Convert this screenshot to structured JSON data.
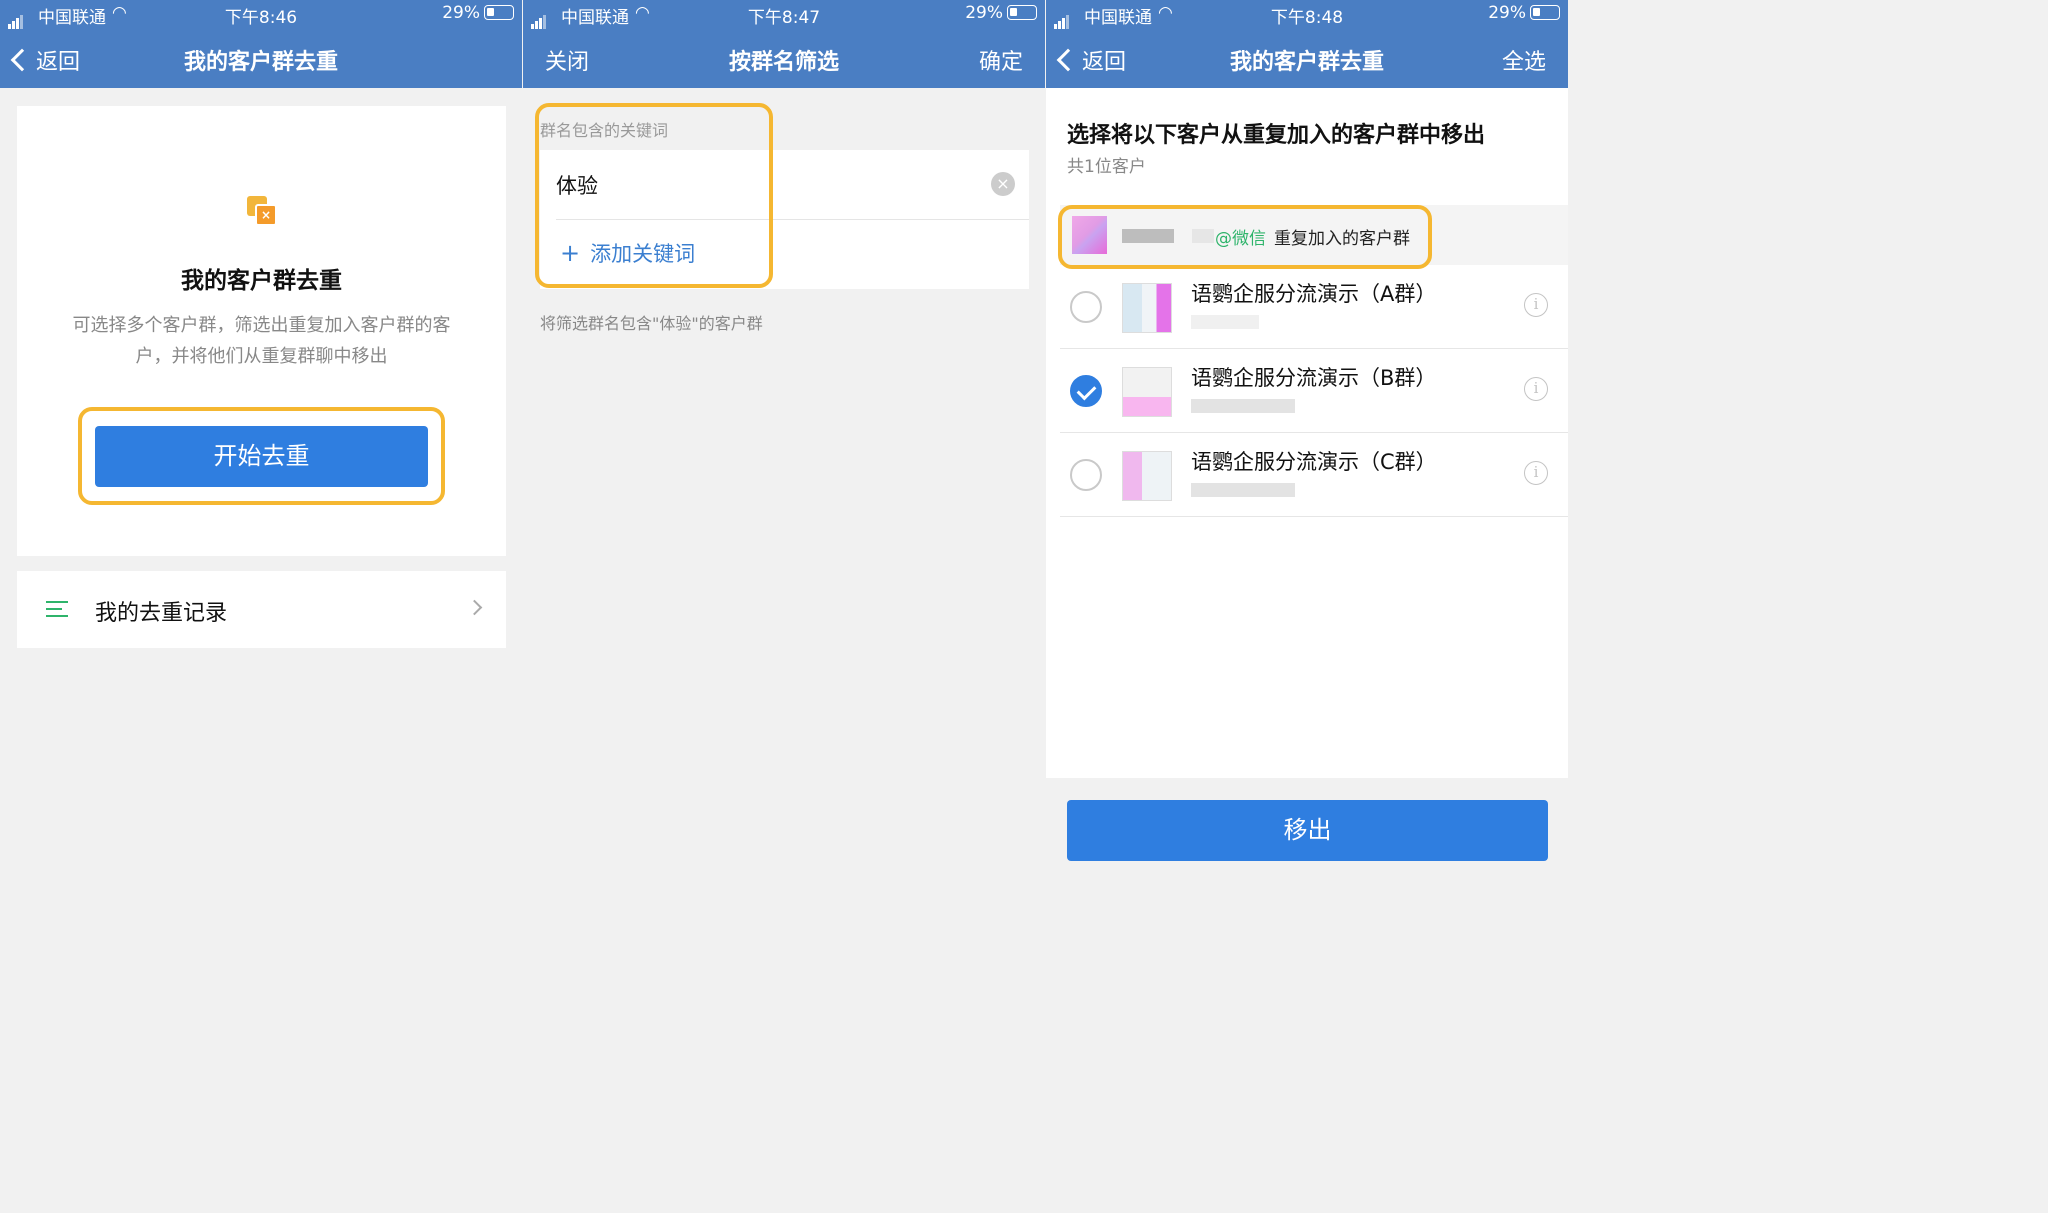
{
  "screens": [
    {
      "status": {
        "carrier": "中国联通",
        "time": "下午8:46",
        "battery": "29%"
      },
      "nav": {
        "back_label": "返回",
        "title": "我的客户群去重"
      },
      "card": {
        "heading": "我的客户群去重",
        "description": "可选择多个客户群，筛选出重复加入客户群的客户，并将他们从重复群聊中移出",
        "start_button": "开始去重"
      },
      "records": {
        "label": "我的去重记录"
      }
    },
    {
      "status": {
        "carrier": "中国联通",
        "time": "下午8:47",
        "battery": "29%"
      },
      "nav": {
        "close_label": "关闭",
        "title": "按群名筛选",
        "confirm_label": "确定"
      },
      "keyword_label": "群名包含的关键词",
      "keyword_value": "体验",
      "add_keyword": "添加关键词",
      "hint": "将筛选群名包含\"体验\"的客户群"
    },
    {
      "status": {
        "carrier": "中国联通",
        "time": "下午8:48",
        "battery": "29%"
      },
      "nav": {
        "back_label": "返回",
        "title": "我的客户群去重",
        "select_all_label": "全选"
      },
      "title": "选择将以下客户从重复加入的客户群中移出",
      "subtitle": "共1位客户",
      "customer": {
        "wechat_tag": "@微信",
        "dup_label": "重复加入的客户群"
      },
      "groups": [
        {
          "name": "语鹦企服分流演示（A群）",
          "selected": false
        },
        {
          "name": "语鹦企服分流演示（B群）",
          "selected": true
        },
        {
          "name": "语鹦企服分流演示（C群）",
          "selected": false
        }
      ],
      "remove_button": "移出"
    }
  ],
  "icons": [
    "signal-icon",
    "wifi-icon",
    "battery-icon",
    "back-chevron-icon",
    "dedupe-logo-icon",
    "list-icon",
    "chevron-right-icon",
    "clear-icon",
    "plus-icon",
    "check-icon",
    "info-icon"
  ],
  "colors": {
    "nav_bar": "#4a7ec3",
    "primary_button": "#2f7ee0",
    "highlight": "#f5b731",
    "wechat": "#2fb46b",
    "link": "#3b7fd0"
  }
}
